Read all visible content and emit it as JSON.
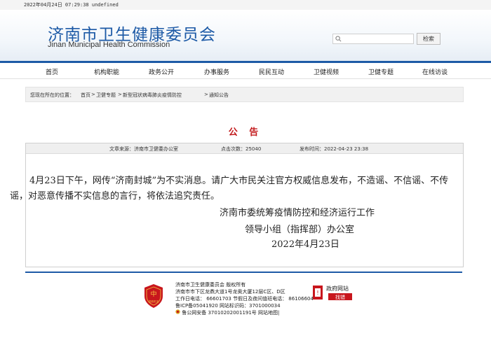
{
  "topbar": {
    "datetime": "2022年04月24日  07:29:38  undefined"
  },
  "header": {
    "title": "济南市卫生健康委员会",
    "subtitle": "Jinan Municipal Health Commission",
    "search": {
      "placeholder": "",
      "button_label": "检索"
    }
  },
  "nav": {
    "items": [
      "首页",
      "机构职能",
      "政务公开",
      "办事服务",
      "民民互动",
      "卫健视频",
      "卫健专题",
      "在线访谈"
    ]
  },
  "breadcrumb": {
    "prefix": "您现在所在的位置：",
    "items": [
      "首页",
      "卫健专题",
      "新型冠状病毒肺炎疫情防控",
      "通知公告"
    ],
    "separator": ">"
  },
  "article": {
    "title": "公 告",
    "source": "文章来源：济南市卫健委办公室",
    "clicks": "点击次数：25040",
    "published": "发布时间：2022-04-23 23:38",
    "paragraph": "4月23日下午，网传“济南封城”为不实消息。请广大市民关注官方权威信息发布，不造谣、不信谣、不传谣，对恶意传播不实信息的言行，将依法追究责任。",
    "signature_line1": "济南市委统筹疫情防控和经济运行工作",
    "signature_line2": "领导小组（指挥部）办公室",
    "date": "2022年4月23日"
  },
  "footer": {
    "line1": "济南市卫生健康委员会  版权所有",
    "line2": "济南市市下区龙鼎大道1号龙奥大厦12层C区、D区",
    "line3": "工作日电话：  66601703  节假日及夜间值班电话：  86106604",
    "line4": "鲁ICP备05041920  网站标识码：3701000034",
    "line5": "鲁公网安备  37010202001191号  网站地图|",
    "gov_badge_line1": "政府网站",
    "gov_badge_line2": "找错",
    "emblem_text": "党政机关"
  },
  "colors": {
    "brand_blue": "#1d5aa6",
    "title_red": "#c2191b"
  }
}
